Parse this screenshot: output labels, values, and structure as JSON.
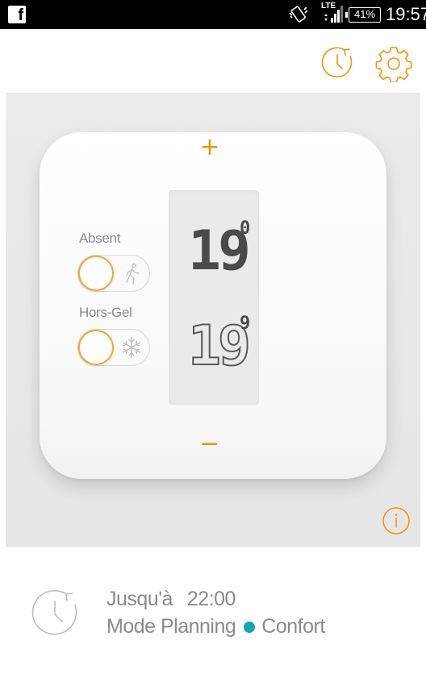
{
  "status_bar": {
    "facebook_glyph": "f",
    "network_label": "LTE",
    "battery": "41%",
    "time": "19:57"
  },
  "header": {
    "title": ""
  },
  "thermostat": {
    "increase_symbol": "+",
    "decrease_symbol": "−",
    "setpoint_main": "19",
    "setpoint_decimal": "0",
    "ambient_main": "19",
    "ambient_decimal": "9",
    "away_label": "Absent",
    "frost_label": "Hors-Gel",
    "away_on": false,
    "frost_on": false
  },
  "footer": {
    "until_label": "Jusqu'à",
    "until_time": "22:00",
    "mode_label": "Mode Planning",
    "comfort_label": "Confort"
  },
  "icons": {
    "history": "history-clock-icon",
    "settings": "gear-icon",
    "info": "info-icon",
    "away": "walking-person-icon",
    "frost": "snowflake-icon",
    "schedule": "schedule-clock-icon"
  },
  "colors": {
    "accent": "#f39200",
    "mode_dot": "#17a3b4",
    "text_gray": "#8a8a8a",
    "display_digits": "#4a4a4a"
  }
}
